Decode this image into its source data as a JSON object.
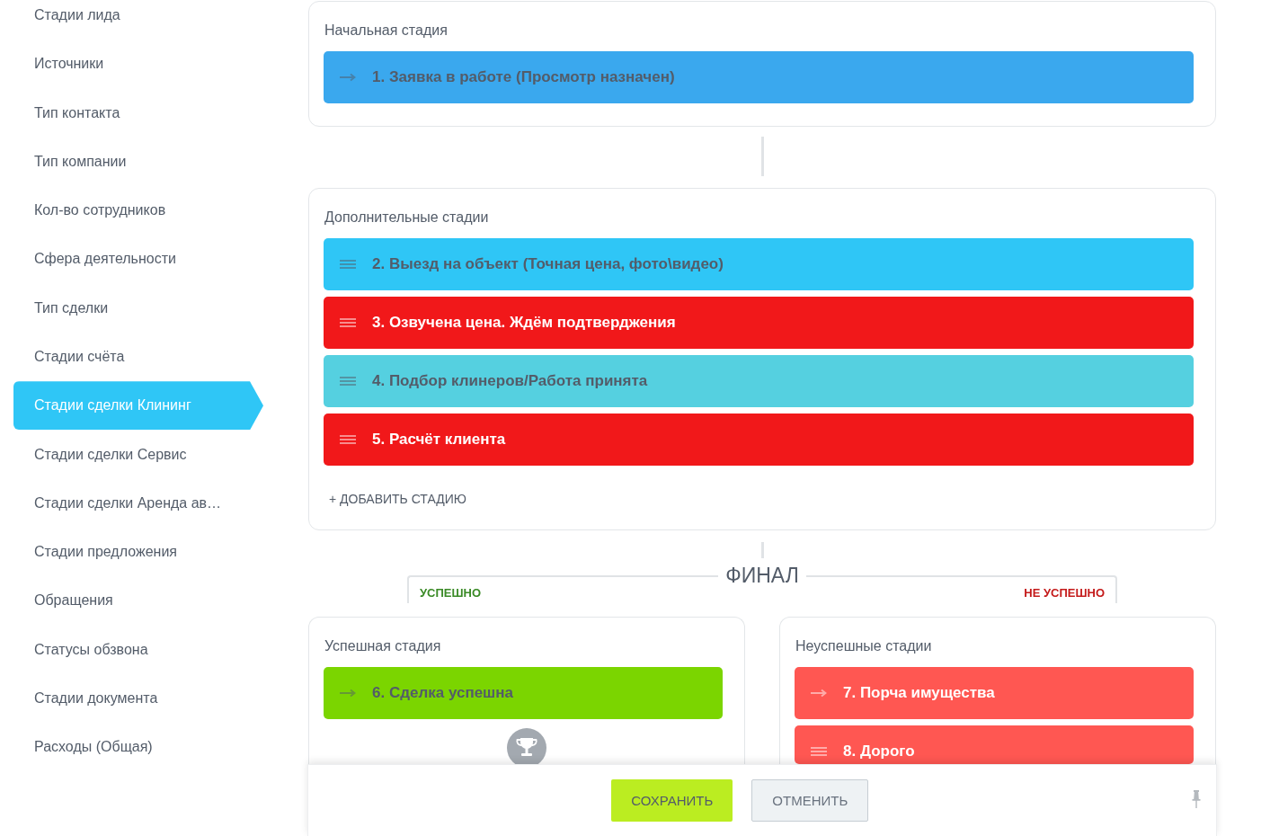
{
  "sidebar": {
    "items": [
      {
        "label": "Стадии лида",
        "selected": false
      },
      {
        "label": "Источники",
        "selected": false
      },
      {
        "label": "Тип контакта",
        "selected": false
      },
      {
        "label": "Тип компании",
        "selected": false
      },
      {
        "label": "Кол-во сотрудников",
        "selected": false
      },
      {
        "label": "Сфера деятельности",
        "selected": false
      },
      {
        "label": "Тип сделки",
        "selected": false
      },
      {
        "label": "Стадии счёта",
        "selected": false
      },
      {
        "label": "Стадии сделки Клининг",
        "selected": true
      },
      {
        "label": "Стадии сделки Сервис",
        "selected": false
      },
      {
        "label": "Стадии сделки Аренда ав…",
        "selected": false
      },
      {
        "label": "Стадии предложения",
        "selected": false
      },
      {
        "label": "Обращения",
        "selected": false
      },
      {
        "label": "Статусы обзвона",
        "selected": false
      },
      {
        "label": "Стадии документа",
        "selected": false
      },
      {
        "label": "Расходы (Общая)",
        "selected": false
      }
    ]
  },
  "initial_section": {
    "title": "Начальная стадия",
    "stages": [
      {
        "label": "1. Заявка в работе (Просмотр назначен)",
        "kind": "fixed",
        "color": "#3aa8ee"
      }
    ]
  },
  "additional_section": {
    "title": "Дополнительные стадии",
    "stages": [
      {
        "label": "2. Выезд на объект (Точная цена, фото\\видео)",
        "kind": "movable",
        "color": "#2fc6f6"
      },
      {
        "label": "3. Озвучена цена. Ждём подтверджения",
        "kind": "movable",
        "color": "#f1181a"
      },
      {
        "label": "4. Подбор клинеров/Работа принята",
        "kind": "movable",
        "color": "#55d0e0"
      },
      {
        "label": "5. Расчёт клиента",
        "kind": "movable",
        "color": "#f1181a"
      }
    ],
    "add_button": "+ ДОБАВИТЬ СТАДИЮ"
  },
  "final": {
    "title": "ФИНАЛ",
    "success": {
      "tab": "УСПЕШНО",
      "title": "Успешная стадия",
      "stages": [
        {
          "label": "6. Сделка успешна",
          "kind": "fixed",
          "color": "#7bd500"
        }
      ]
    },
    "failure": {
      "tab": "НЕ УСПЕШНО",
      "title": "Неуспешные стадии",
      "stages": [
        {
          "label": "7. Порча имущества",
          "kind": "fixed",
          "color": "#ff5752"
        },
        {
          "label": "8. Дорого",
          "kind": "movable",
          "color": "#ff5752"
        }
      ]
    }
  },
  "footer": {
    "buttons": [
      {
        "label": "СОХРАНИТЬ",
        "kind": "primary"
      },
      {
        "label": "ОТМЕНИТЬ",
        "kind": "secondary"
      }
    ]
  }
}
